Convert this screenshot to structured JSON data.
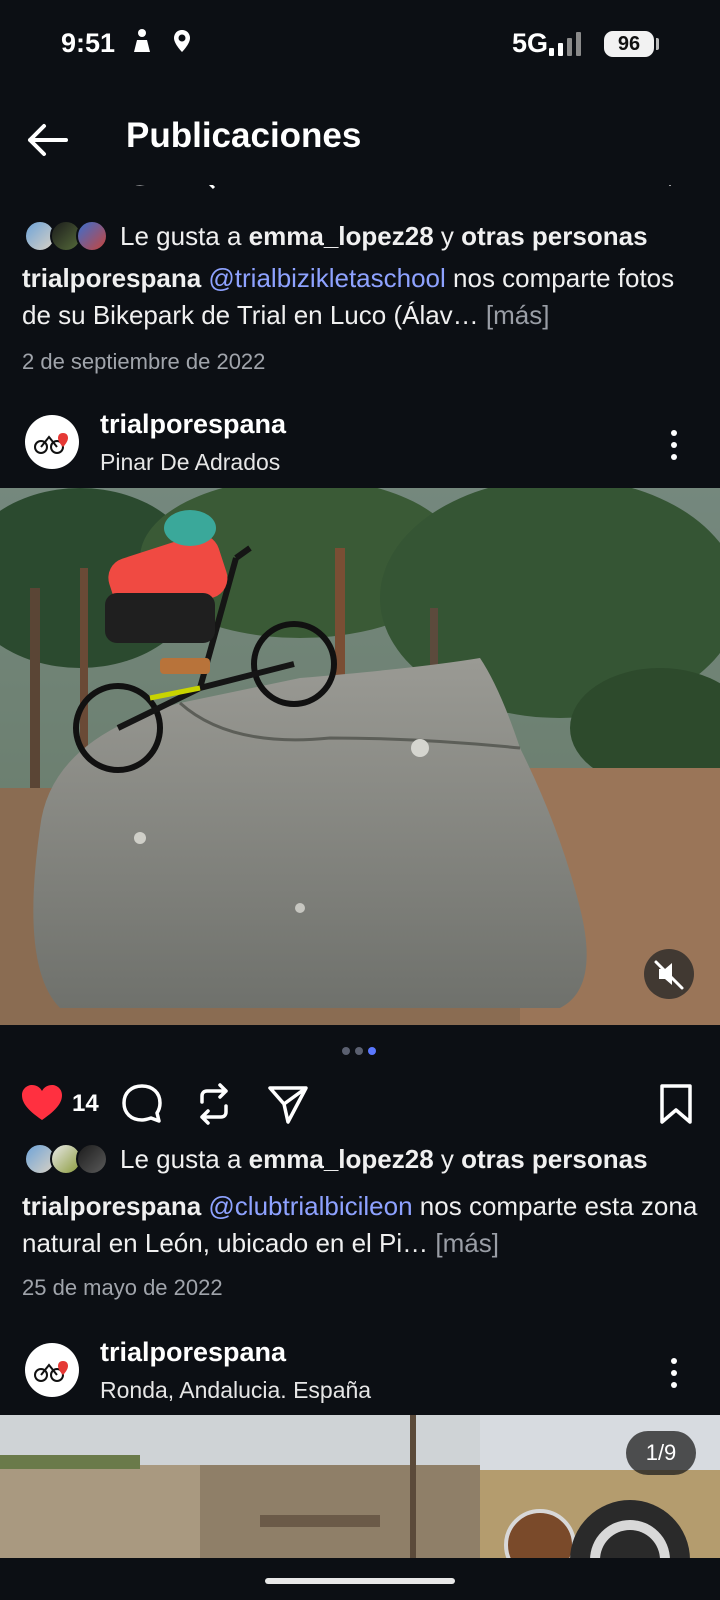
{
  "status_bar": {
    "time": "9:51",
    "network": "5G",
    "battery": "96"
  },
  "header": {
    "title": "Publicaciones"
  },
  "post1": {
    "likes_prefix": "Le gusta a",
    "liked_by": "emma_lopez28",
    "likes_conj": "y",
    "likes_others": "otras personas",
    "author": "trialporespana",
    "mention": "@trialbizikletaschool",
    "caption_rest": "nos comparte fotos de su Bikepark de Trial en Luco (Álav…",
    "more": "[más]",
    "date": "2 de septiembre de 2022"
  },
  "post2": {
    "username": "trialporespana",
    "location": "Pinar De Adrados",
    "like_count": "14",
    "likes_prefix": "Le gusta a",
    "liked_by": "emma_lopez28",
    "likes_conj": "y",
    "likes_others": "otras personas",
    "author": "trialporespana",
    "mention": "@clubtrialbicileon",
    "caption_rest": "nos comparte esta zona natural en León, ubicado en el Pi…",
    "more": "[más]",
    "date": "25 de mayo de 2022",
    "carousel": {
      "count": 3,
      "active": 3
    },
    "liked": true
  },
  "post3": {
    "username": "trialporespana",
    "location": "Ronda, Andalucia. España",
    "counter": "1/9"
  },
  "colors": {
    "like": "#ff3040",
    "mention": "#8ea2ff",
    "accent_dot": "#5b78ff"
  },
  "icons": [
    "back-arrow-icon",
    "heart-icon",
    "comment-icon",
    "repost-icon",
    "share-icon",
    "bookmark-icon",
    "kebab-icon",
    "mute-icon"
  ]
}
